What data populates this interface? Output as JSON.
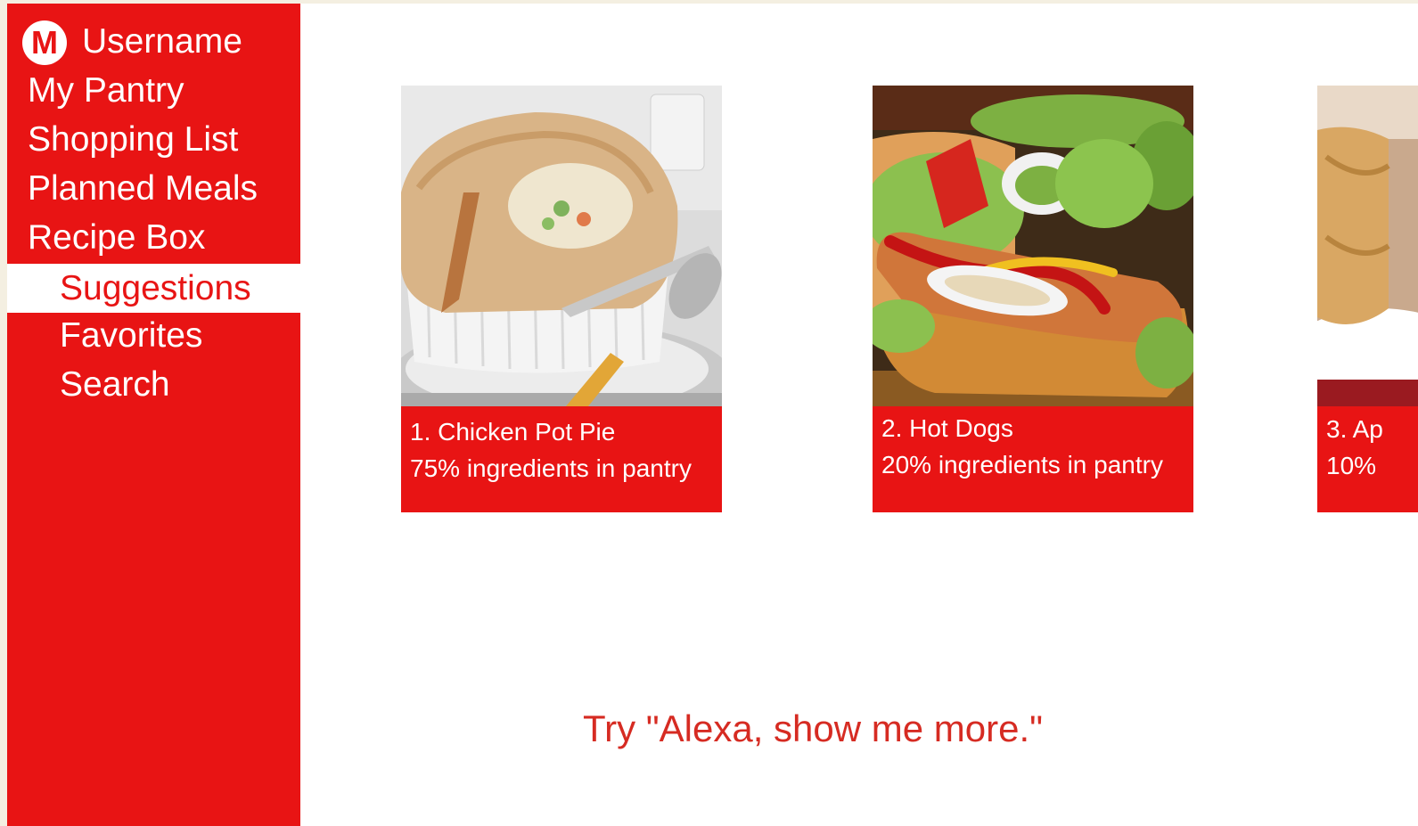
{
  "sidebar": {
    "logo_letter": "M",
    "username": "Username",
    "items": [
      {
        "label": "My Pantry"
      },
      {
        "label": "Shopping List"
      },
      {
        "label": "Planned Meals"
      },
      {
        "label": "Recipe Box"
      },
      {
        "label": "Suggestions",
        "active": true
      },
      {
        "label": "Favorites"
      },
      {
        "label": "Search"
      }
    ]
  },
  "suggestions": [
    {
      "title": "1. Chicken Pot Pie",
      "subtitle": "75% ingredients in pantry"
    },
    {
      "title": "2. Hot Dogs",
      "subtitle": "20% ingredients in pantry"
    },
    {
      "title": "3. Ap",
      "subtitle": "10%"
    }
  ],
  "hint": "Try \"Alexa, show me more.\"",
  "colors": {
    "accent": "#e81414",
    "hint_text": "#d62b22",
    "background": "#ffffff",
    "outer": "#f4efe1"
  }
}
